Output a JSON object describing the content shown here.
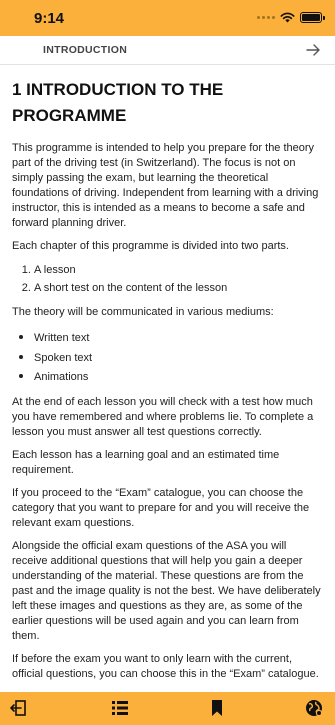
{
  "status_bar": {
    "time": "9:14"
  },
  "header": {
    "title": "INTRODUCTION"
  },
  "article": {
    "heading": "1 INTRODUCTION TO THE PROGRAMME",
    "intro": "This programme is intended to help you prepare for the theory part of the driving test (in Switzerland). The focus is not on simply passing the exam, but learning the theoretical foundations of driving. Independent from learning with a driving instructor, this is intended as a means to become a safe and forward planning driver.",
    "parts_intro": "Each chapter of this programme is divided into two parts.",
    "parts": [
      "A lesson",
      "A short test on the content of the lesson"
    ],
    "mediums_intro": "The theory will be communicated in various mediums:",
    "mediums": [
      "Written text",
      "Spoken text",
      "Animations"
    ],
    "test_info": "At the end of each lesson you will check with a test how much you have remembered and where problems lie. To complete a lesson you must answer all test questions correctly.",
    "goal_info": "Each lesson has a learning goal and an estimated time requirement.",
    "exam_info": "If you proceed to the “Exam” catalogue, you can choose the category that you want to prepare for and you will receive the relevant exam questions.",
    "asa_info": "Alongside the official exam questions of the ASA you will receive additional questions that will help you gain a deeper understanding of the material. These questions are from the past and the image quality is not the best. We have deliberately left these images and questions as they are, as some of the earlier questions will be used again and you can learn from them.",
    "current_info": "If before the exam you want to only learn with the current, official questions, you can choose this in the “Exam” catalogue."
  },
  "toolbar": {
    "icons": [
      "exit-icon",
      "menu-list-icon",
      "bookmark-icon",
      "globe-settings-icon"
    ]
  },
  "colors": {
    "accent": "#fbb03b",
    "text": "#222222"
  }
}
